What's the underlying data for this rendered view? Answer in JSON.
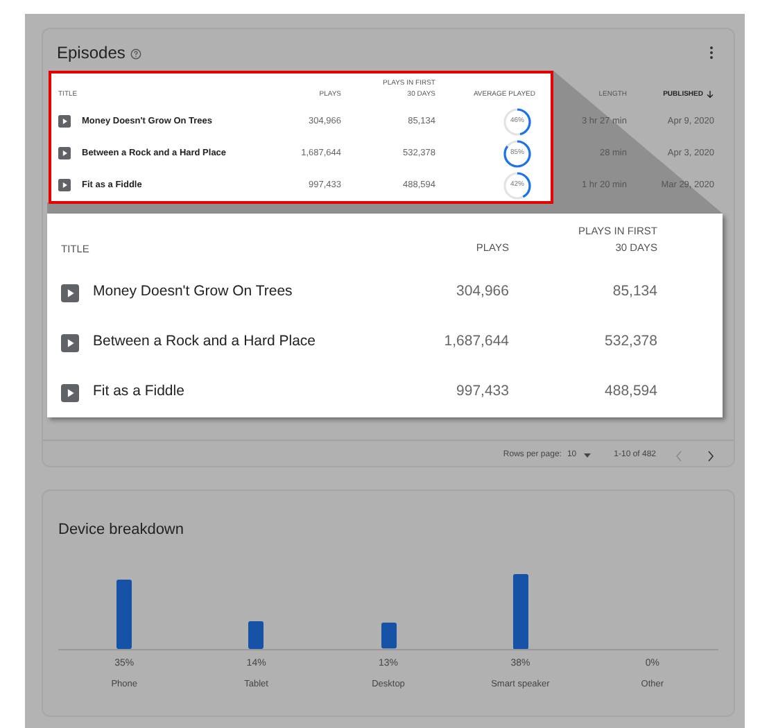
{
  "episodes": {
    "title": "Episodes",
    "columns": [
      {
        "lines": [
          "TITLE"
        ]
      },
      {
        "lines": [
          "PLAYS"
        ]
      },
      {
        "lines": [
          "PLAYS IN FIRST",
          "30 DAYS"
        ]
      },
      {
        "lines": [
          "AVERAGE PLAYED"
        ]
      },
      {
        "lines": [
          "LENGTH"
        ],
        "sorted": false
      },
      {
        "lines": [
          "PUBLISHED"
        ],
        "sorted": true
      }
    ],
    "rows": [
      {
        "title": "Money Doesn't Grow On Trees",
        "plays": "304,966",
        "plays_first_30_days": "85,134",
        "average_played": "46%",
        "length": "3 hr 27 min",
        "published": "Apr 9, 2020"
      },
      {
        "title": "Between a Rock and a Hard Place",
        "plays": "1,687,644",
        "plays_first_30_days": "532,378",
        "average_played": "85%",
        "length": "28 min",
        "published": "Apr 3, 2020"
      },
      {
        "title": "Fit as a Fiddle",
        "plays": "997,433",
        "plays_first_30_days": "488,594",
        "average_played": "42%",
        "length": "1 hr 20 min",
        "published": "Mar 29, 2020"
      }
    ],
    "callout": {
      "columns": [
        [
          "TITLE"
        ],
        [
          "PLAYS"
        ],
        [
          "PLAYS IN FIRST",
          "30 DAYS"
        ]
      ],
      "rows": [
        {
          "title": "Money Doesn't Grow On Trees",
          "plays": "304,966",
          "plays_first_30_days": "85,134"
        },
        {
          "title": "Between a Rock and a Hard Place",
          "plays": "1,687,644",
          "plays_first_30_days": "532,378"
        },
        {
          "title": "Fit as a Fiddle",
          "plays": "997,433",
          "plays_first_30_days": "488,594"
        }
      ]
    },
    "pagination": {
      "rows_per_page_label": "Rows per page:",
      "rows_per_page": "10",
      "range": "1-10 of 482",
      "previous_disabled": true,
      "next_disabled": false
    }
  },
  "device_breakdown": {
    "title": "Device breakdown",
    "chart_data": {
      "type": "bar",
      "categories": [
        "Phone",
        "Tablet",
        "Desktop",
        "Smart speaker",
        "Other"
      ],
      "values": [
        35,
        14,
        13,
        38,
        0
      ],
      "value_labels": [
        "35%",
        "14%",
        "13%",
        "38%",
        "0%"
      ]
    }
  }
}
